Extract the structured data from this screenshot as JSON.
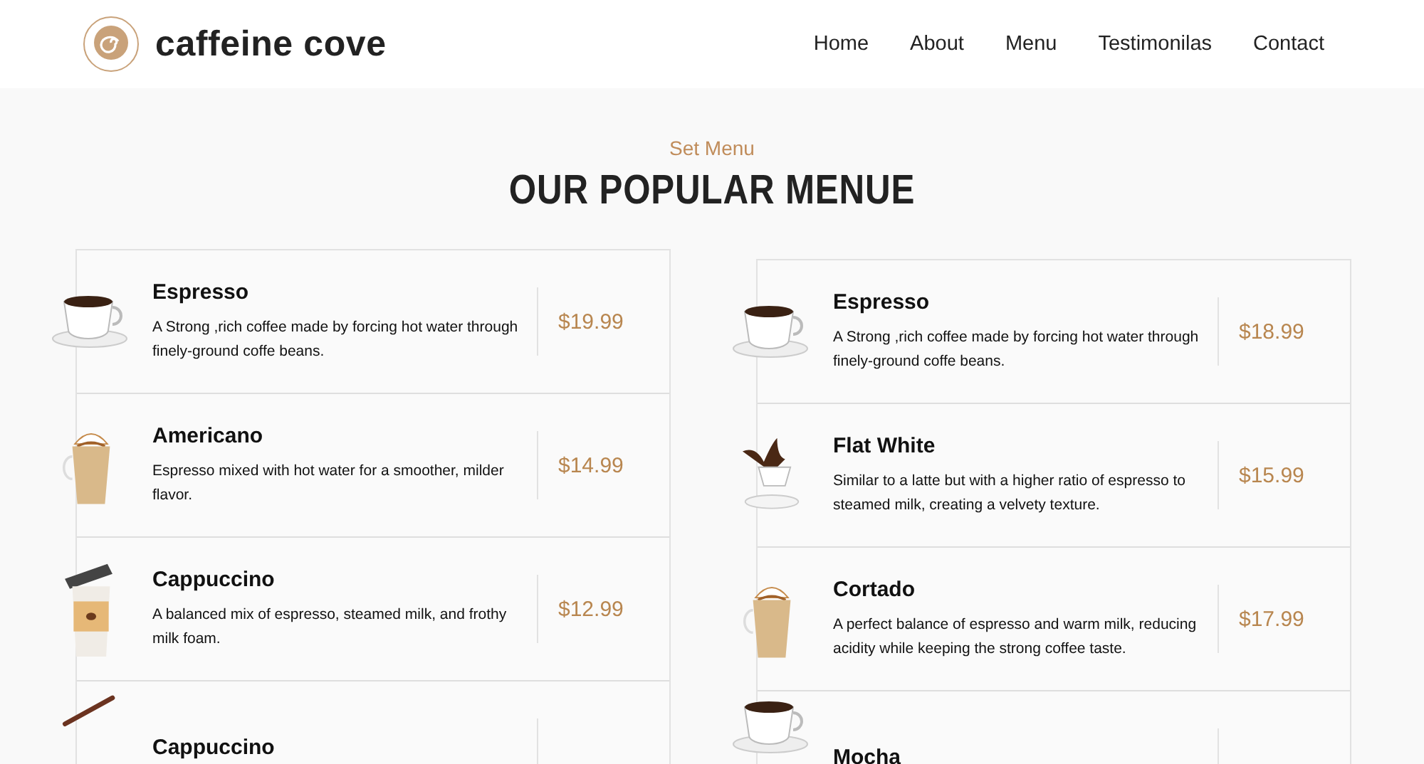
{
  "header": {
    "brand": "caffeine cove",
    "nav": [
      "Home",
      "About",
      "Menu",
      "Testimonilas",
      "Contact"
    ]
  },
  "section": {
    "eyebrow": "Set Menu",
    "title": "OUR POPULAR MENUE"
  },
  "columns": [
    {
      "items": [
        {
          "kind": "cup",
          "name": "Espresso",
          "description": "A Strong ,rich coffee made by forcing hot water through finely-ground coffe beans.",
          "price": "$19.99"
        },
        {
          "kind": "glass",
          "name": "Americano",
          "description": "Espresso mixed with hot water for a smoother, milder flavor.",
          "price": "$14.99"
        },
        {
          "kind": "takeaway",
          "name": "Cappuccino",
          "description": "A balanced mix of espresso, steamed milk, and frothy milk foam.",
          "price": "$12.99"
        },
        {
          "kind": "stick",
          "name": "Cappuccino"
        }
      ]
    },
    {
      "items": [
        {
          "kind": "cup",
          "name": "Espresso",
          "description": "A Strong ,rich coffee made by forcing hot water through finely-ground coffe beans.",
          "price": "$18.99"
        },
        {
          "kind": "splash",
          "name": "Flat White",
          "description": "Similar to a latte but with a higher ratio of espresso to steamed milk, creating a velvety texture.",
          "price": "$15.99"
        },
        {
          "kind": "glass",
          "name": "Cortado",
          "description": "A perfect balance of espresso and warm milk, reducing acidity while keeping the strong coffee taste.",
          "price": "$17.99"
        },
        {
          "kind": "cup",
          "name": "Mocha"
        }
      ]
    }
  ]
}
